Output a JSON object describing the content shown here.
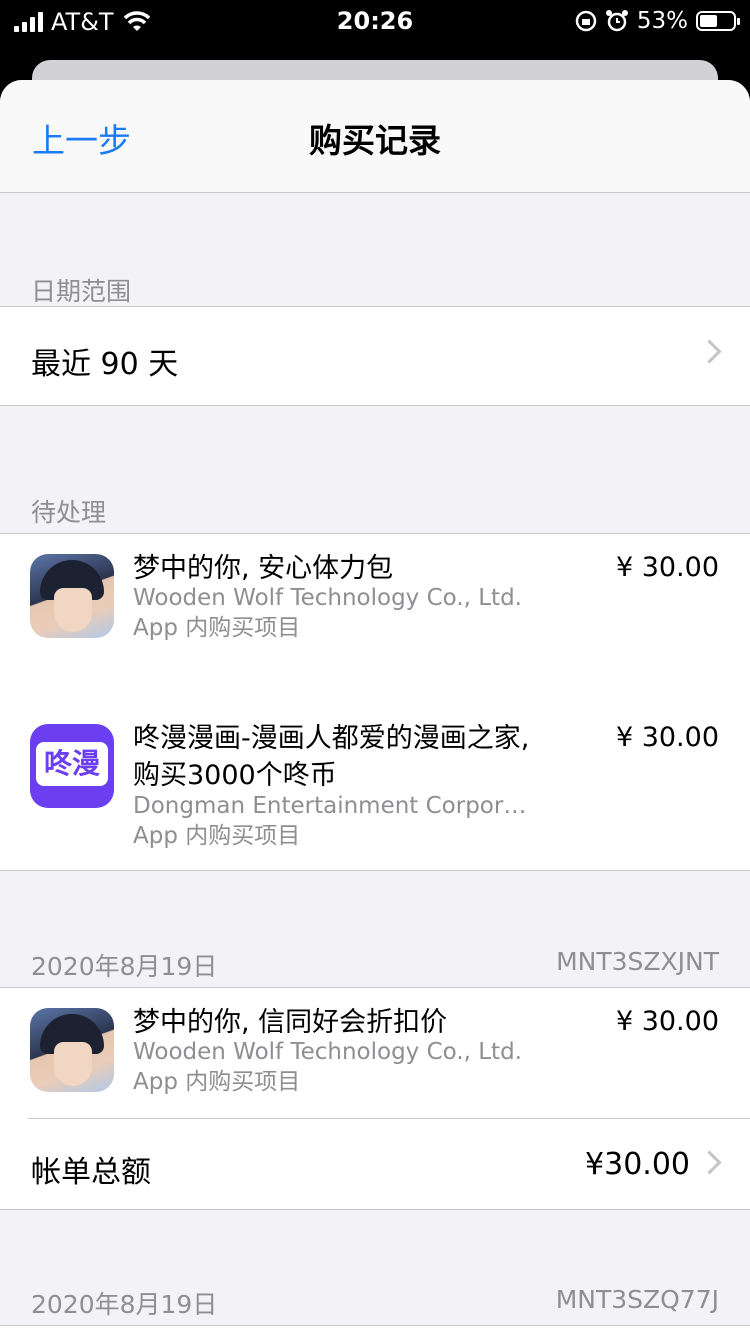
{
  "status_bar": {
    "carrier": "AT&T",
    "time": "20:26",
    "battery": "53%",
    "battery_level": 0.53
  },
  "nav": {
    "back_label": "上一步",
    "title": "购买记录"
  },
  "date_range": {
    "header": "日期范围",
    "value": "最近 90 天"
  },
  "pending": {
    "header": "待处理",
    "items": [
      {
        "title": "梦中的你, 安心体力包",
        "developer": "Wooden Wolf Technology Co., Ltd.",
        "type": "App 内购买项目",
        "price": "¥ 30.00",
        "icon": "anime-character-icon"
      },
      {
        "title": "咚漫漫画-漫画人都爱的漫画之家, 购买3000个咚币",
        "developer": "Dongman Entertainment Corpora...",
        "type": "App 内购买项目",
        "price": "¥ 30.00",
        "icon": "dongman-app-icon",
        "icon_text": "咚漫"
      }
    ]
  },
  "orders": [
    {
      "date": "2020年8月19日",
      "order_id": "MNT3SZXJNT",
      "items": [
        {
          "title": "梦中的你, 信同好会折扣价",
          "developer": "Wooden Wolf Technology Co., Ltd.",
          "type": "App 内购买项目",
          "price": "¥ 30.00",
          "icon": "anime-character-icon"
        }
      ],
      "total_label": "帐单总额",
      "total_value": "¥30.00"
    },
    {
      "date": "2020年8月19日",
      "order_id": "MNT3SZQ77J"
    }
  ]
}
